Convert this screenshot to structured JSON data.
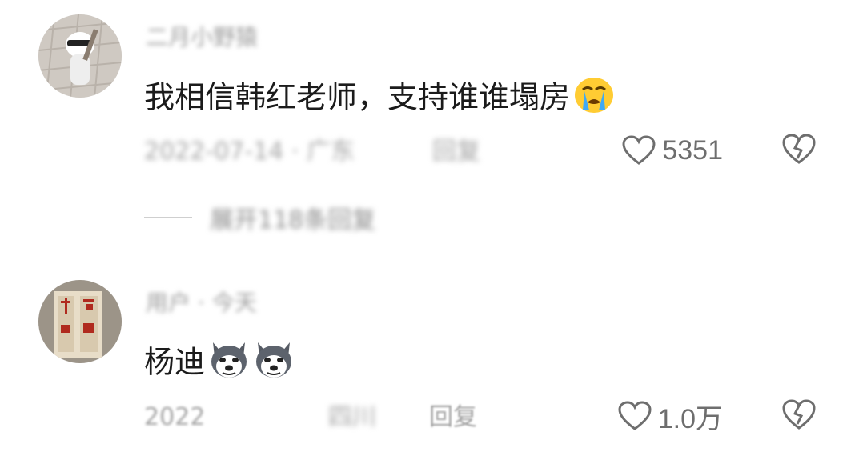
{
  "comments": [
    {
      "username": "二月小野猿",
      "text": "我相信韩红老师，支持谁谁塌房",
      "emoji": "crying-face-icon",
      "meta": "2022-07-14 · 广东",
      "reply_label": "回复",
      "likes": "5351",
      "replies_label": "展开118条回复"
    },
    {
      "username": "用户 · 今天",
      "text": "杨迪",
      "emoji": "husky-dog-icon",
      "meta_date": "2022",
      "meta_loc": "四川",
      "reply_label": "回复",
      "likes": "1.0万"
    }
  ]
}
